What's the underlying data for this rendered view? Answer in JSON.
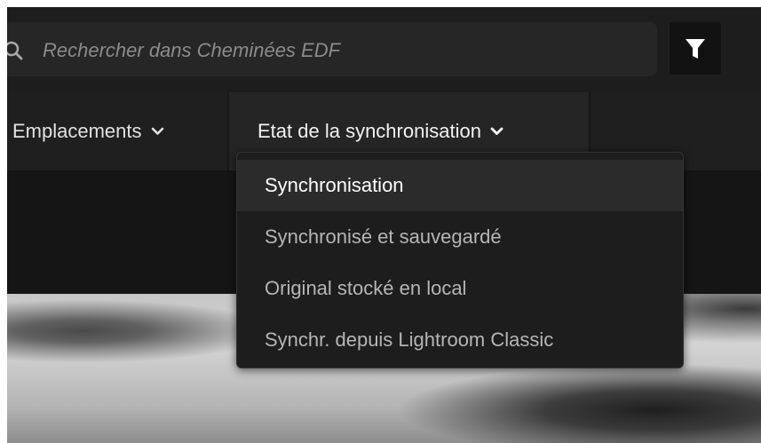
{
  "search": {
    "placeholder": "Rechercher dans Cheminées EDF",
    "icon": "search-icon"
  },
  "filter": {
    "icon": "filter-icon"
  },
  "tabs": [
    {
      "label": "Emplacements",
      "icon": "chevron-down-icon"
    },
    {
      "label": "Etat de la synchronisation",
      "icon": "chevron-down-icon",
      "active": true
    }
  ],
  "dropdown": {
    "items": [
      {
        "label": "Synchronisation",
        "selected": true
      },
      {
        "label": "Synchronisé et sauvegardé"
      },
      {
        "label": "Original stocké en local"
      },
      {
        "label": "Synchr. depuis Lightroom Classic"
      }
    ]
  },
  "colors": {
    "background": "#1a1a1a",
    "menu_background": "#1d1d1d",
    "selected_item": "#2b2b2b",
    "text": "#e2e2e2",
    "placeholder": "#8b8b8b"
  }
}
